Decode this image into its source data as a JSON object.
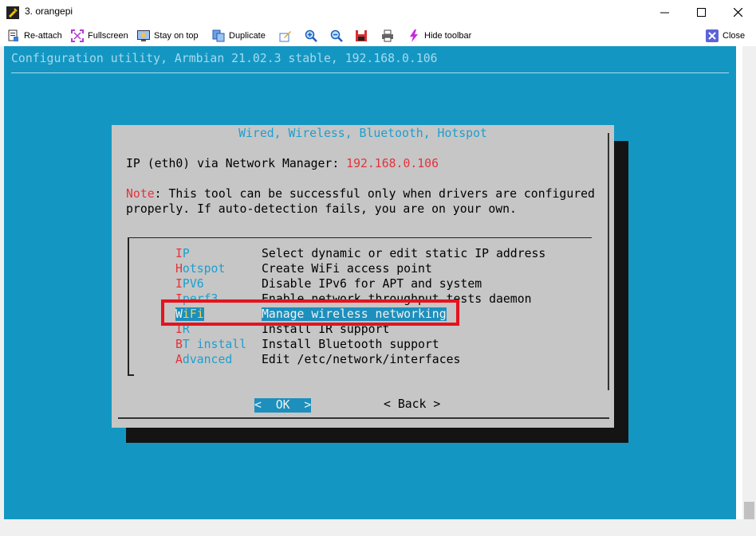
{
  "window": {
    "title": "3. orangepi"
  },
  "toolbar": {
    "items": [
      {
        "label": "Re-attach",
        "icon": "reattach-icon"
      },
      {
        "label": "Fullscreen",
        "icon": "fullscreen-icon"
      },
      {
        "label": "Stay on top",
        "icon": "stay-on-top-icon"
      },
      {
        "label": "Duplicate",
        "icon": "duplicate-icon"
      },
      {
        "label": "",
        "icon": "edit-icon"
      },
      {
        "label": "",
        "icon": "zoom-in-icon"
      },
      {
        "label": "",
        "icon": "zoom-out-icon"
      },
      {
        "label": "",
        "icon": "save-icon"
      },
      {
        "label": "",
        "icon": "print-icon"
      },
      {
        "label": "Hide toolbar",
        "icon": "lightning-icon"
      },
      {
        "label": "Close",
        "icon": "close-x-icon"
      }
    ]
  },
  "terminal": {
    "header": "Configuration utility, Armbian 21.02.3 stable, 192.168.0.106",
    "dialog": {
      "title": "Wired, Wireless, Bluetooth, Hotspot",
      "ip_label": "IP (eth0) via Network Manager: ",
      "ip_value": "192.168.0.106",
      "note_label": "Note",
      "note_text": ": This tool can be successful only when drivers are configured",
      "note_text2": "properly. If auto-detection fails, you are on your own.",
      "menu": [
        {
          "hot": "I",
          "rest": "P",
          "desc": "Select dynamic or edit static IP address"
        },
        {
          "hot": "H",
          "rest": "otspot",
          "desc": "Create WiFi access point"
        },
        {
          "hot": "I",
          "rest": "PV6",
          "desc": "Disable IPv6 for APT and system"
        },
        {
          "hot": "I",
          "rest": "perf3",
          "desc": "Enable network throughput tests daemon"
        },
        {
          "hot": "W",
          "rest": "iFi",
          "desc": "Manage wireless networking",
          "selected": true
        },
        {
          "hot": "I",
          "rest": "R",
          "desc": "Install IR support"
        },
        {
          "hot": "B",
          "rest": "T install",
          "desc": "Install Bluetooth support"
        },
        {
          "hot": "A",
          "rest": "dvanced",
          "desc": "Edit /etc/network/interfaces"
        }
      ],
      "ok_button": "<  OK  >",
      "back_button": "< Back >"
    }
  },
  "colors": {
    "terminal_bg": "#1397c2",
    "dialog_bg": "#c6c6c6",
    "highlight": "#e3141e",
    "selection": "#1c8fbd"
  }
}
